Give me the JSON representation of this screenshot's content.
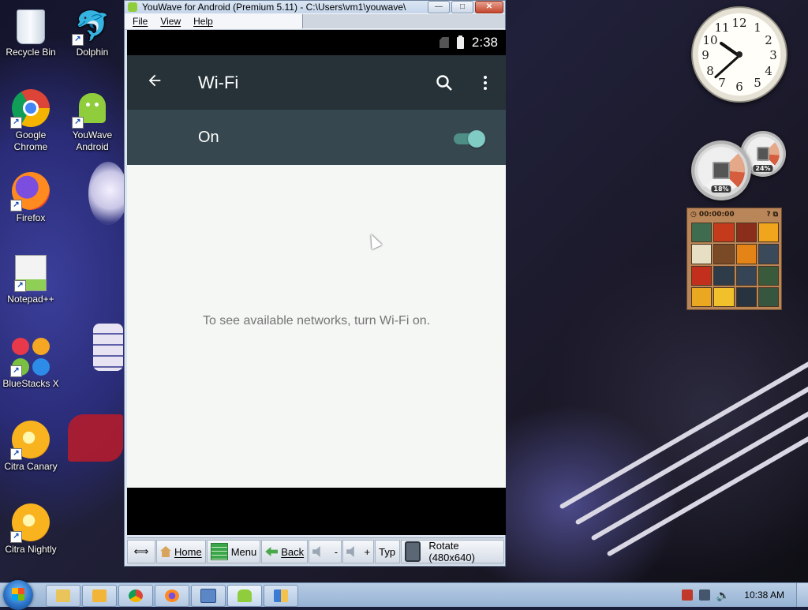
{
  "desktop": {
    "icons": [
      {
        "label": "Recycle Bin",
        "icon": "recycle-bin-icon"
      },
      {
        "label": "Dolphin",
        "icon": "dolphin-icon"
      },
      {
        "label": "Google Chrome",
        "icon": "chrome-icon"
      },
      {
        "label": "YouWave Android",
        "icon": "android-icon"
      },
      {
        "label": "Firefox",
        "icon": "firefox-icon"
      },
      {
        "label": "Notepad++",
        "icon": "notepad-icon"
      },
      {
        "label": "BlueStacks X",
        "icon": "bluestacks-icon"
      },
      {
        "label": "Citra Canary",
        "icon": "citra-canary-icon"
      },
      {
        "label": "Citra Nightly",
        "icon": "citra-nightly-icon"
      }
    ]
  },
  "gadgets": {
    "clock": {
      "numbers": [
        "12",
        "1",
        "2",
        "3",
        "4",
        "5",
        "6",
        "7",
        "8",
        "9",
        "10",
        "11"
      ],
      "time": "10:38"
    },
    "cpu_meter": {
      "cpu_percent": "18%",
      "memory_percent": "24%"
    },
    "puzzle": {
      "timer": "00:00:00"
    }
  },
  "window": {
    "title": "YouWave for Android (Premium 5.11) - C:\\Users\\vm1\\youwave\\",
    "menu": [
      "File",
      "View",
      "Help"
    ],
    "controls": {
      "minimize": "—",
      "maximize": "□",
      "close": "✕"
    },
    "controlbar": {
      "resize": "⟺",
      "home": "Home",
      "menu": "Menu",
      "back": "Back",
      "vol_down": "-",
      "vol_up": "+",
      "type": "Typ",
      "rotate": "Rotate (480x640)"
    }
  },
  "android": {
    "status_time": "2:38",
    "toolbar_title": "Wi-Fi",
    "switch_label": "On",
    "switch_state": true,
    "empty_message": "To see available networks, turn Wi-Fi on.",
    "colors": {
      "toolbar": "#263238",
      "switchbar": "#37474f",
      "accent": "#80cbc4",
      "background": "#f4f7f4"
    }
  },
  "taskbar": {
    "clock": "10:38 AM",
    "pinned": [
      "explorer-icon",
      "media-player-icon",
      "chrome-icon",
      "firefox-icon",
      "remote-desktop-icon",
      "youwave-icon",
      "control-panel-icon"
    ]
  }
}
